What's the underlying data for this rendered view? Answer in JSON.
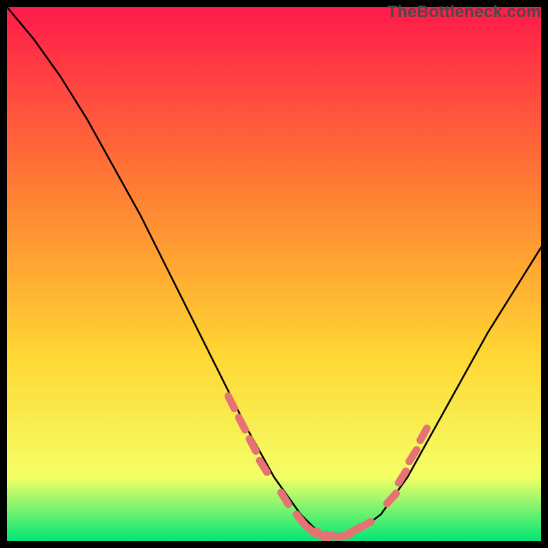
{
  "watermark": "TheBottleneck.com",
  "colors": {
    "background": "#000000",
    "gradient_top": "#ff1a4a",
    "gradient_mid": "#ffd633",
    "gradient_bottom": "#00e676",
    "curve": "#000000",
    "markers": "#e57373"
  },
  "chart_data": {
    "type": "line",
    "title": "",
    "xlabel": "",
    "ylabel": "",
    "xlim": [
      0,
      100
    ],
    "ylim": [
      0,
      100
    ],
    "curve": {
      "x": [
        0,
        5,
        10,
        15,
        20,
        25,
        30,
        35,
        40,
        45,
        50,
        55,
        58,
        60,
        63,
        66,
        70,
        75,
        80,
        85,
        90,
        95,
        100
      ],
      "y": [
        100,
        94,
        87,
        79,
        70,
        61,
        51,
        41,
        31,
        21,
        12,
        5,
        2,
        1,
        1,
        2,
        5,
        12,
        21,
        30,
        39,
        47,
        55
      ]
    },
    "markers": {
      "x": [
        42,
        44,
        46,
        48,
        52,
        55,
        57,
        59,
        61,
        63,
        65,
        67,
        72,
        74,
        76,
        78
      ],
      "y": [
        26,
        22,
        18,
        14,
        8,
        4,
        2,
        1,
        1,
        1,
        2,
        3,
        8,
        12,
        16,
        20
      ]
    }
  }
}
